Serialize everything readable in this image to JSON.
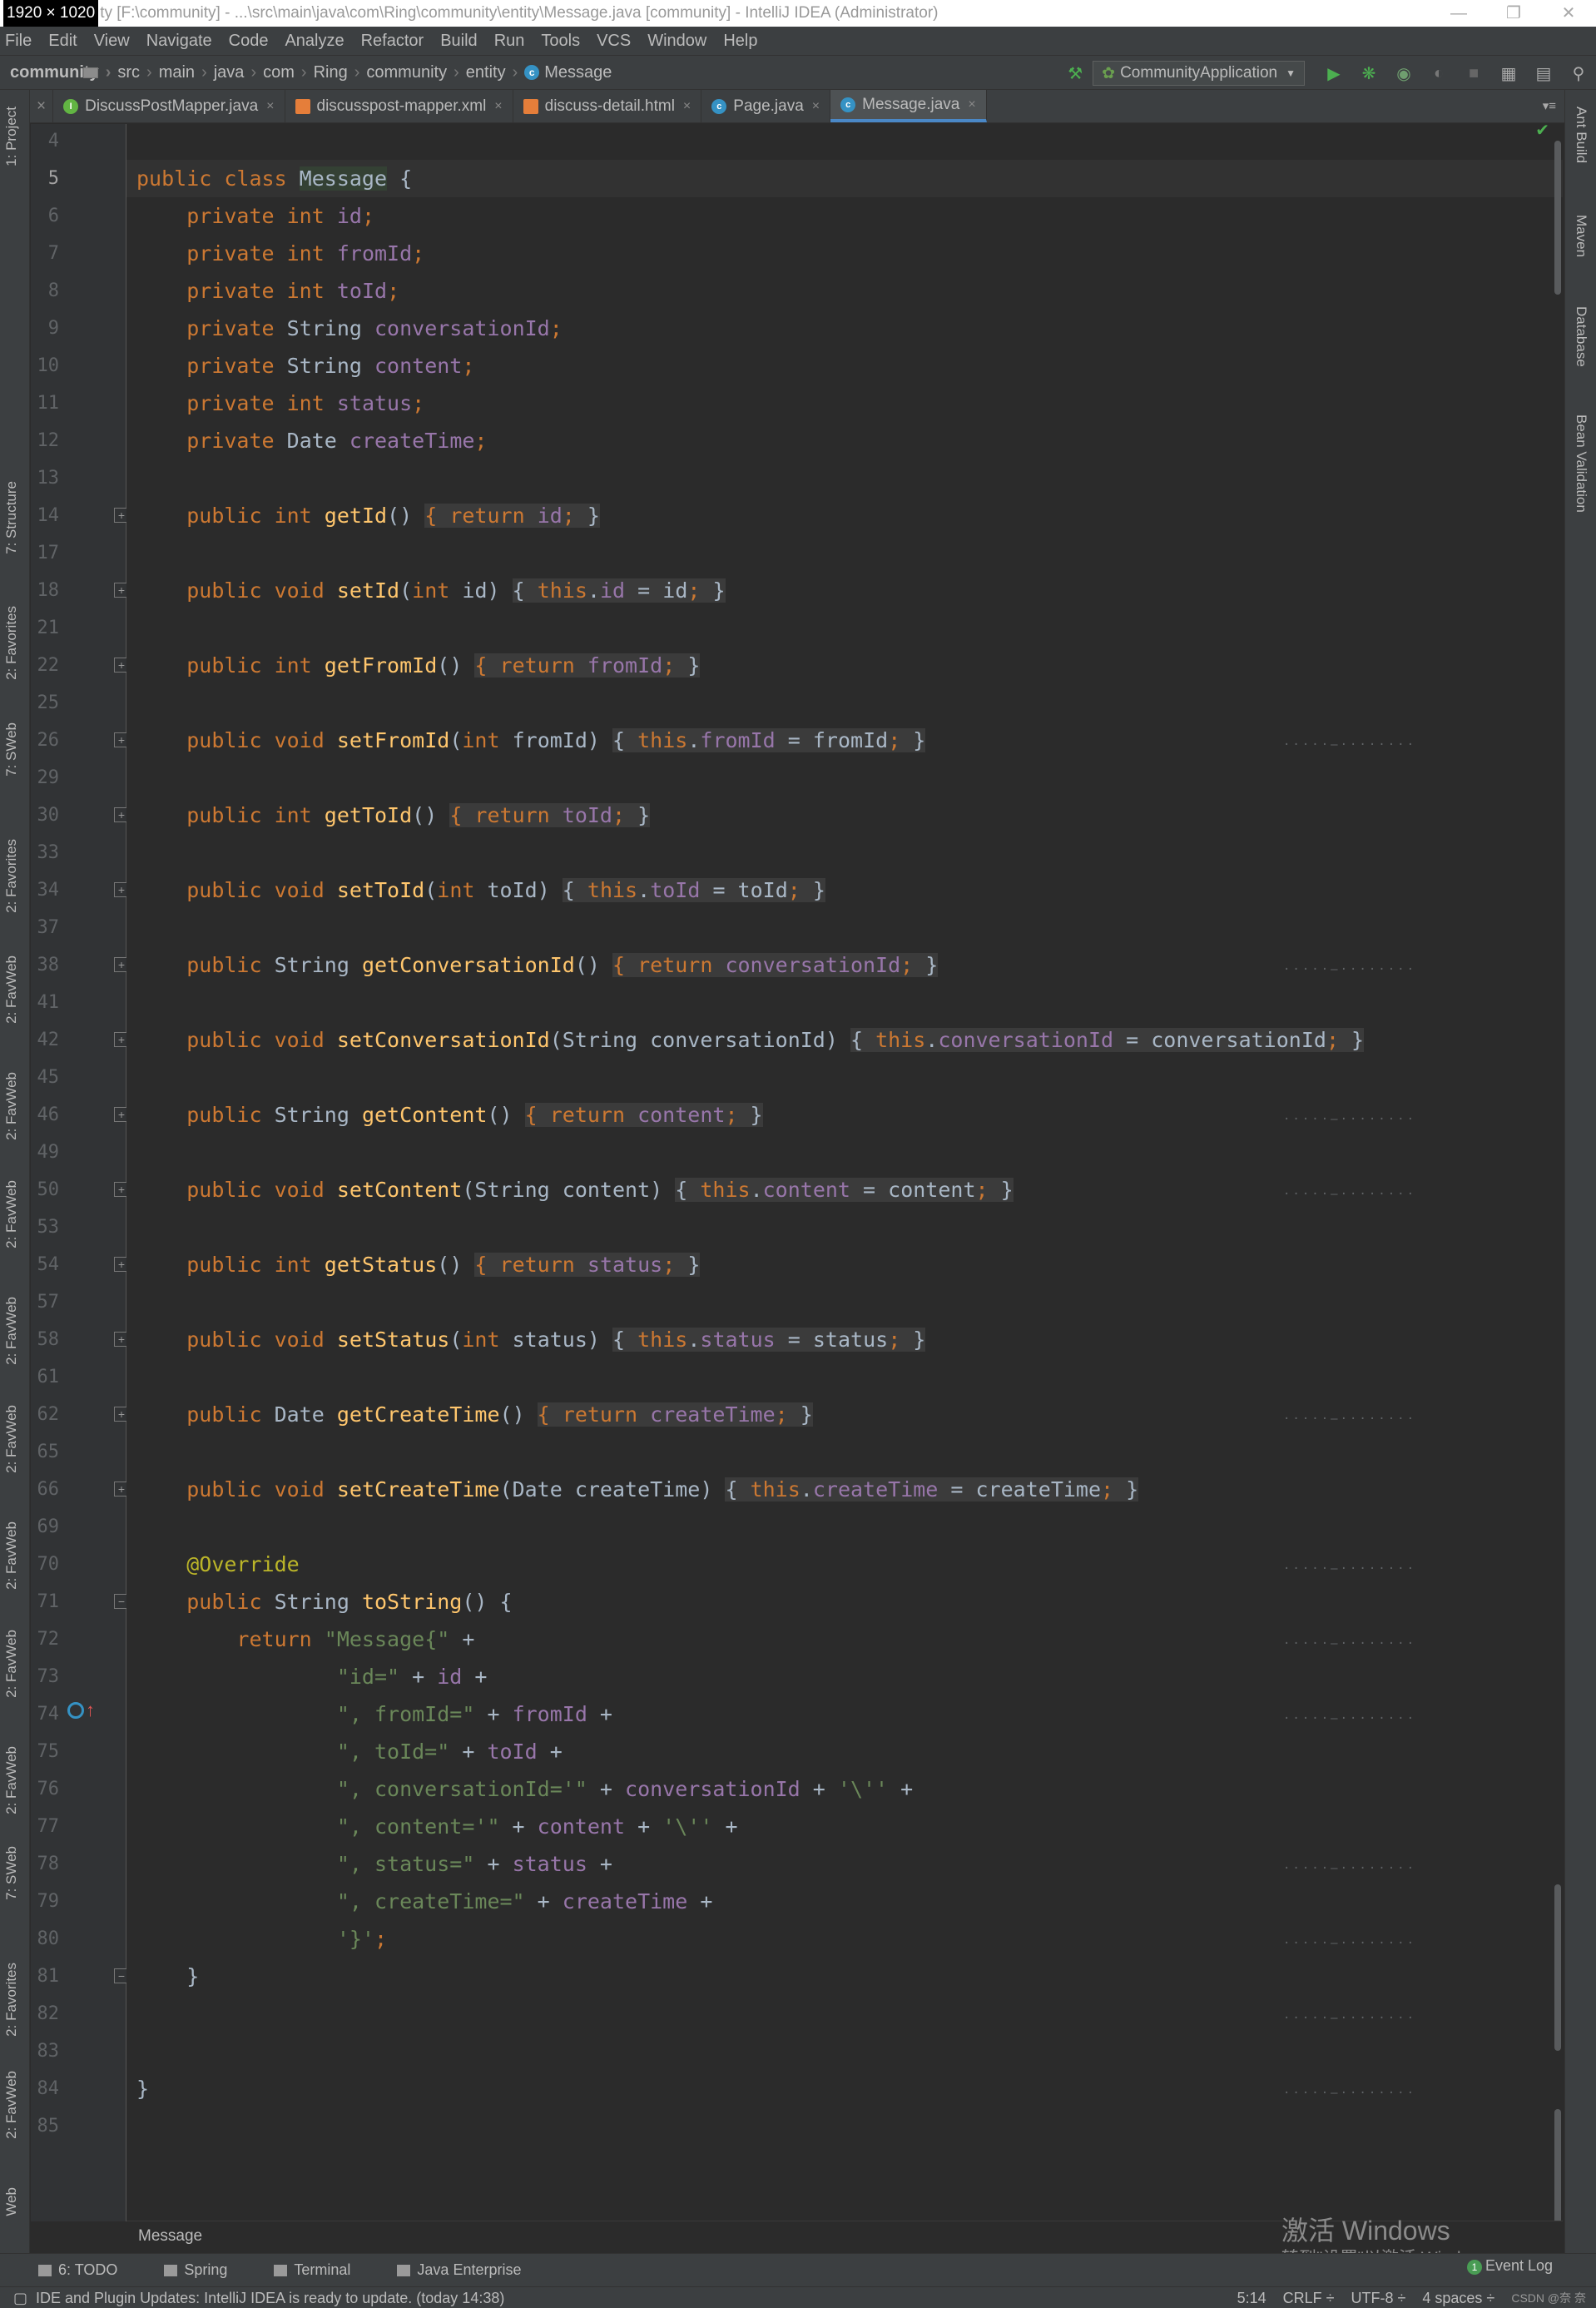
{
  "window": {
    "dims_badge": "1920 × 1020",
    "title": "ty [F:\\community] - ...\\src\\main\\java\\com\\Ring\\community\\entity\\Message.java [community] - IntelliJ IDEA (Administrator)"
  },
  "menu": [
    "File",
    "Edit",
    "View",
    "Navigate",
    "Code",
    "Analyze",
    "Refactor",
    "Build",
    "Run",
    "Tools",
    "VCS",
    "Window",
    "Help"
  ],
  "breadcrumb": [
    "community",
    "src",
    "main",
    "java",
    "com",
    "Ring",
    "community",
    "entity",
    "Message"
  ],
  "run_config": "CommunityApplication",
  "tabs": [
    {
      "label": "DiscussPostMapper.java",
      "icon": "I"
    },
    {
      "label": "discusspost-mapper.xml",
      "icon": "x"
    },
    {
      "label": "discuss-detail.html",
      "icon": "h"
    },
    {
      "label": "Page.java",
      "icon": "c"
    },
    {
      "label": "Message.java",
      "icon": "c"
    }
  ],
  "left_strip": [
    "1: Project",
    "7: Structure",
    "2: Favorites",
    "7: SWeb",
    "2: Favorites",
    "2: FavWeb",
    "2: FavWeb",
    "2: FavWeb",
    "2: FavWeb",
    "2: FavWeb",
    "2: FavWeb",
    "2: FavWeb",
    "2: FavWeb",
    "7: SWeb",
    "2: Favorites",
    "2: FavWeb",
    "Web"
  ],
  "right_strip": [
    "Ant Build",
    "Maven",
    "Database",
    "Bean Validation"
  ],
  "code_lines": [
    {
      "n": "4",
      "html": ""
    },
    {
      "n": "5",
      "html": "<span class='kw'>public class </span><span class='clsH'>Message</span> {"
    },
    {
      "n": "6",
      "html": "    <span class='kw'>private int </span><span class='fd'>id</span><span class='kw'>;</span>"
    },
    {
      "n": "7",
      "html": "    <span class='kw'>private int </span><span class='fd'>fromId</span><span class='kw'>;</span>"
    },
    {
      "n": "8",
      "html": "    <span class='kw'>private int </span><span class='fd'>toId</span><span class='kw'>;</span>"
    },
    {
      "n": "9",
      "html": "    <span class='kw'>private </span>String <span class='fd'>conversationId</span><span class='kw'>;</span>"
    },
    {
      "n": "10",
      "html": "    <span class='kw'>private </span>String <span class='fd'>content</span><span class='kw'>;</span>"
    },
    {
      "n": "11",
      "html": "    <span class='kw'>private int </span><span class='fd'>status</span><span class='kw'>;</span>"
    },
    {
      "n": "12",
      "html": "    <span class='kw'>private </span>Date <span class='fd'>createTime</span><span class='kw'>;</span>"
    },
    {
      "n": "13",
      "html": ""
    },
    {
      "n": "14",
      "html": "    <span class='kw'>public int </span><span class='fn'>getId</span>() <span class='fb'>{ return </span><span class='fbw'><span class='fd'>id</span><span class='kw'>; </span>}</span>",
      "fold": "+"
    },
    {
      "n": "17",
      "html": ""
    },
    {
      "n": "18",
      "html": "    <span class='kw'>public void </span><span class='fn'>setId</span>(<span class='kw'>int </span>id) <span class='fbw'>{ <span class='kw'>this</span>.<span class='fd'>id</span> = id<span class='kw'>; </span>}</span>",
      "fold": "+"
    },
    {
      "n": "21",
      "html": ""
    },
    {
      "n": "22",
      "html": "    <span class='kw'>public int </span><span class='fn'>getFromId</span>() <span class='fb'>{ return </span><span class='fbw'><span class='fd'>fromId</span><span class='kw'>; </span>}</span>",
      "fold": "+"
    },
    {
      "n": "25",
      "html": ""
    },
    {
      "n": "26",
      "html": "    <span class='kw'>public void </span><span class='fn'>setFromId</span>(<span class='kw'>int </span>fromId) <span class='fbw'>{ <span class='kw'>this</span>.<span class='fd'>fromId</span> = fromId<span class='kw'>; </span>}</span>",
      "fold": "+"
    },
    {
      "n": "29",
      "html": ""
    },
    {
      "n": "30",
      "html": "    <span class='kw'>public int </span><span class='fn'>getToId</span>() <span class='fb'>{ return </span><span class='fbw'><span class='fd'>toId</span><span class='kw'>; </span>}</span>",
      "fold": "+"
    },
    {
      "n": "33",
      "html": ""
    },
    {
      "n": "34",
      "html": "    <span class='kw'>public void </span><span class='fn'>setToId</span>(<span class='kw'>int </span>toId) <span class='fbw'>{ <span class='kw'>this</span>.<span class='fd'>toId</span> = toId<span class='kw'>; </span>}</span>",
      "fold": "+"
    },
    {
      "n": "37",
      "html": ""
    },
    {
      "n": "38",
      "html": "    <span class='kw'>public </span>String <span class='fn'>getConversationId</span>() <span class='fb'>{ return </span><span class='fbw'><span class='fd'>conversationId</span><span class='kw'>; </span>}</span>",
      "fold": "+"
    },
    {
      "n": "41",
      "html": ""
    },
    {
      "n": "42",
      "html": "    <span class='kw'>public void </span><span class='fn'>setConversationId</span>(String conversationId) <span class='fbw'>{ <span class='kw'>this</span>.<span class='fd'>conversationId</span> = conversationId<span class='kw'>; </span>}</span>",
      "fold": "+"
    },
    {
      "n": "45",
      "html": ""
    },
    {
      "n": "46",
      "html": "    <span class='kw'>public </span>String <span class='fn'>getContent</span>() <span class='fb'>{ return </span><span class='fbw'><span class='fd'>content</span><span class='kw'>; </span>}</span>",
      "fold": "+"
    },
    {
      "n": "49",
      "html": ""
    },
    {
      "n": "50",
      "html": "    <span class='kw'>public void </span><span class='fn'>setContent</span>(String content) <span class='fbw'>{ <span class='kw'>this</span>.<span class='fd'>content</span> = content<span class='kw'>; </span>}</span>",
      "fold": "+"
    },
    {
      "n": "53",
      "html": ""
    },
    {
      "n": "54",
      "html": "    <span class='kw'>public int </span><span class='fn'>getStatus</span>() <span class='fb'>{ return </span><span class='fbw'><span class='fd'>status</span><span class='kw'>; </span>}</span>",
      "fold": "+"
    },
    {
      "n": "57",
      "html": ""
    },
    {
      "n": "58",
      "html": "    <span class='kw'>public void </span><span class='fn'>setStatus</span>(<span class='kw'>int </span>status) <span class='fbw'>{ <span class='kw'>this</span>.<span class='fd'>status</span> = status<span class='kw'>; </span>}</span>",
      "fold": "+"
    },
    {
      "n": "61",
      "html": ""
    },
    {
      "n": "62",
      "html": "    <span class='kw'>public </span>Date <span class='fn'>getCreateTime</span>() <span class='fb'>{ return </span><span class='fbw'><span class='fd'>createTime</span><span class='kw'>; </span>}</span>",
      "fold": "+"
    },
    {
      "n": "65",
      "html": ""
    },
    {
      "n": "66",
      "html": "    <span class='kw'>public void </span><span class='fn'>setCreateTime</span>(Date createTime) <span class='fbw'>{ <span class='kw'>this</span>.<span class='fd'>createTime</span> = createTime<span class='kw'>; </span>}</span>",
      "fold": "+"
    },
    {
      "n": "69",
      "html": ""
    },
    {
      "n": "70",
      "html": "    <span class='an'>@Override</span>"
    },
    {
      "n": "71",
      "html": "    <span class='kw'>public </span>String <span class='fn'>toString</span>() {",
      "fold": "-"
    },
    {
      "n": "72",
      "html": "        <span class='kw'>return </span><span class='st'>\"Message{\"</span> +"
    },
    {
      "n": "73",
      "html": "                <span class='st'>\"id=\"</span> + <span class='fd'>id</span> +"
    },
    {
      "n": "74",
      "html": "                <span class='st'>\", fromId=\"</span> + <span class='fd'>fromId</span> +"
    },
    {
      "n": "75",
      "html": "                <span class='st'>\", toId=\"</span> + <span class='fd'>toId</span> +"
    },
    {
      "n": "76",
      "html": "                <span class='st'>\", conversationId='\"</span> + <span class='fd'>conversationId</span> + <span class='st'>'\\''</span> +"
    },
    {
      "n": "77",
      "html": "                <span class='st'>\", content='\"</span> + <span class='fd'>content</span> + <span class='st'>'\\''</span> +"
    },
    {
      "n": "78",
      "html": "                <span class='st'>\", status=\"</span> + <span class='fd'>status</span> +"
    },
    {
      "n": "79",
      "html": "                <span class='st'>\", createTime=\"</span> + <span class='fd'>createTime</span> +"
    },
    {
      "n": "80",
      "html": "                <span class='st'>'}'</span><span class='kw'>;</span>"
    },
    {
      "n": "81",
      "html": "    }",
      "fold": "-"
    },
    {
      "n": "82",
      "html": ""
    },
    {
      "n": "83",
      "html": ""
    },
    {
      "n": "84",
      "html": "}"
    },
    {
      "n": "85",
      "html": ""
    }
  ],
  "editor_breadcrumb": "Message",
  "bottom_tools": [
    "6: TODO",
    "Spring",
    "Terminal",
    "Java Enterprise"
  ],
  "event_log": {
    "badge": "1",
    "label": "Event Log"
  },
  "status": {
    "message": "IDE and Plugin Updates: IntelliJ IDEA is ready to update. (today 14:38)",
    "position": "5:14",
    "line_sep": "CRLF ÷",
    "encoding": "UTF-8 ÷",
    "indent": "4 spaces ÷",
    "csdn": "CSDN @奈 奈"
  },
  "watermark": {
    "line1": "激活 Windows",
    "line2": "转到\"设置\"以激活 Windows。"
  }
}
